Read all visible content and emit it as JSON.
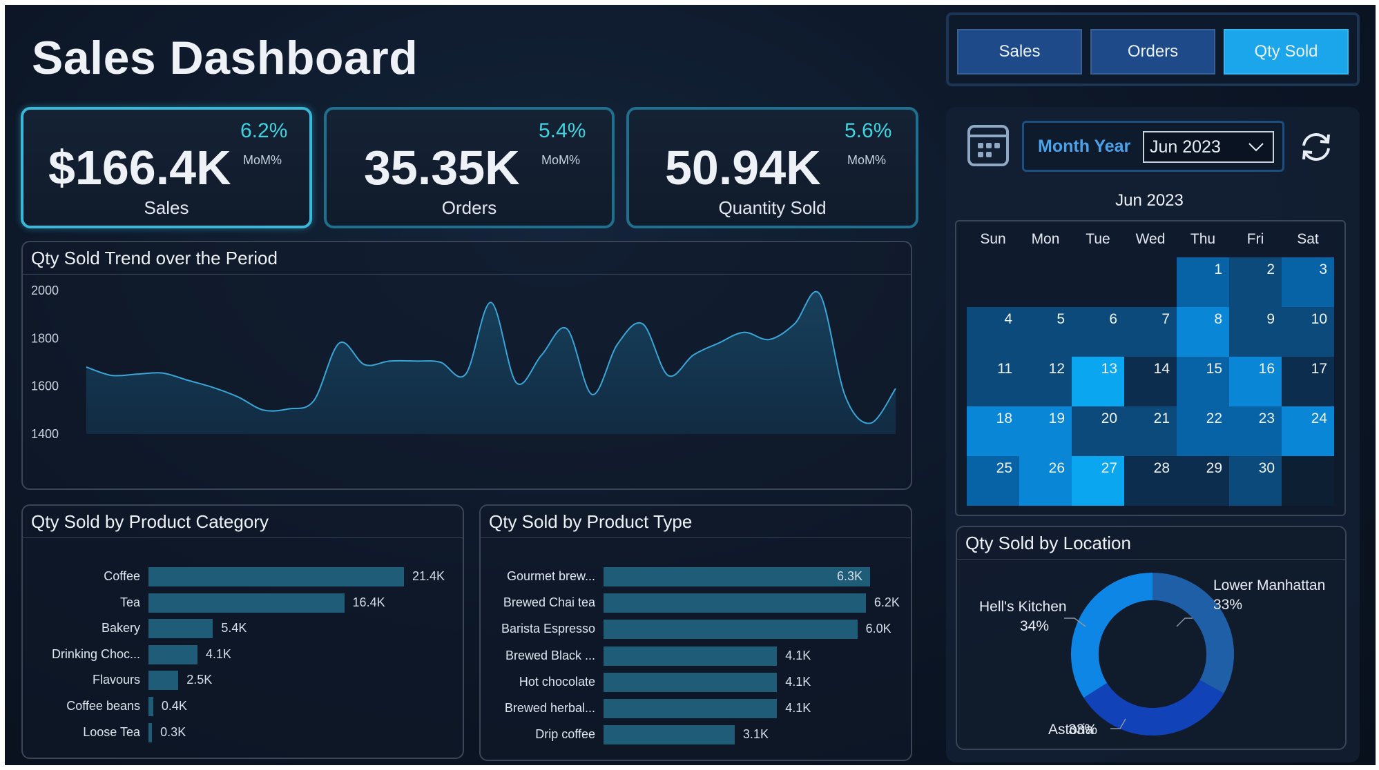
{
  "title": "Sales Dashboard",
  "toggles": [
    {
      "label": "Sales",
      "selected": false
    },
    {
      "label": "Orders",
      "selected": false
    },
    {
      "label": "Qty Sold",
      "selected": true
    }
  ],
  "kpis": [
    {
      "value": "$166.4K",
      "pct": "6.2%",
      "mom": "MoM%",
      "label": "Sales"
    },
    {
      "value": "35.35K",
      "pct": "5.4%",
      "mom": "MoM%",
      "label": "Orders"
    },
    {
      "value": "50.94K",
      "pct": "5.6%",
      "mom": "MoM%",
      "label": "Quantity Sold"
    }
  ],
  "filter": {
    "label": "Month Year",
    "selected": "Jun 2023"
  },
  "calendar": {
    "title": "Jun 2023",
    "weekdays": [
      "Sun",
      "Mon",
      "Tue",
      "Wed",
      "Thu",
      "Fri",
      "Sat"
    ],
    "first_weekday_index": 4,
    "days": 30,
    "intensity": [
      3,
      2,
      3,
      2,
      2,
      2,
      2,
      4,
      2,
      2,
      2,
      2,
      5,
      1,
      3,
      4,
      1,
      4,
      4,
      2,
      2,
      3,
      3,
      4,
      3,
      4,
      5,
      1,
      1,
      2
    ]
  },
  "colors": {
    "accent": "#1ba6ec",
    "kpi_pct": "#3ed3dd",
    "bar": "#1f5c78",
    "heat_levels": [
      "#0f1b2c",
      "#0c2d4d",
      "#0b4a7b",
      "#0862a6",
      "#0a86d6",
      "#0aa6ef"
    ],
    "donut": [
      "#1f5fa8",
      "#0e86e6",
      "#1242b8"
    ]
  },
  "trend": {
    "title": "Qty Sold Trend over the Period",
    "chart_data": {
      "type": "area",
      "y_ticks": [
        "2000",
        "1800",
        "1600",
        "1400"
      ],
      "ylim": [
        1400,
        2000
      ],
      "values": [
        1680,
        1645,
        1650,
        1655,
        1625,
        1595,
        1555,
        1500,
        1505,
        1540,
        1780,
        1690,
        1705,
        1705,
        1700,
        1650,
        1950,
        1615,
        1730,
        1840,
        1565,
        1775,
        1860,
        1645,
        1730,
        1780,
        1825,
        1795,
        1860,
        1985,
        1560,
        1445,
        1590
      ]
    }
  },
  "category": {
    "title": "Qty Sold by Product Category",
    "chart_data": {
      "type": "bar",
      "categories": [
        "Coffee",
        "Tea",
        "Bakery",
        "Drinking Choc...",
        "Flavours",
        "Coffee beans",
        "Loose Tea"
      ],
      "values": [
        21.4,
        16.4,
        5.4,
        4.1,
        2.5,
        0.4,
        0.3
      ],
      "labels": [
        "21.4K",
        "16.4K",
        "5.4K",
        "4.1K",
        "2.5K",
        "0.4K",
        "0.3K"
      ]
    }
  },
  "ptype": {
    "title": "Qty Sold by Product Type",
    "chart_data": {
      "type": "bar",
      "categories": [
        "Gourmet brew...",
        "Brewed Chai tea",
        "Barista Espresso",
        "Brewed Black ...",
        "Hot chocolate",
        "Brewed herbal...",
        "Drip coffee"
      ],
      "values": [
        6.3,
        6.2,
        6.0,
        4.1,
        4.1,
        4.1,
        3.1
      ],
      "labels": [
        "6.3K",
        "6.2K",
        "6.0K",
        "4.1K",
        "4.1K",
        "4.1K",
        "3.1K"
      ]
    }
  },
  "location": {
    "title": "Qty Sold by Location",
    "chart_data": {
      "type": "pie",
      "categories": [
        "Lower Manhattan",
        "Hell's Kitchen",
        "Astoria"
      ],
      "values": [
        33,
        34,
        33
      ],
      "labels": [
        "33%",
        "34%",
        "33%"
      ]
    }
  }
}
